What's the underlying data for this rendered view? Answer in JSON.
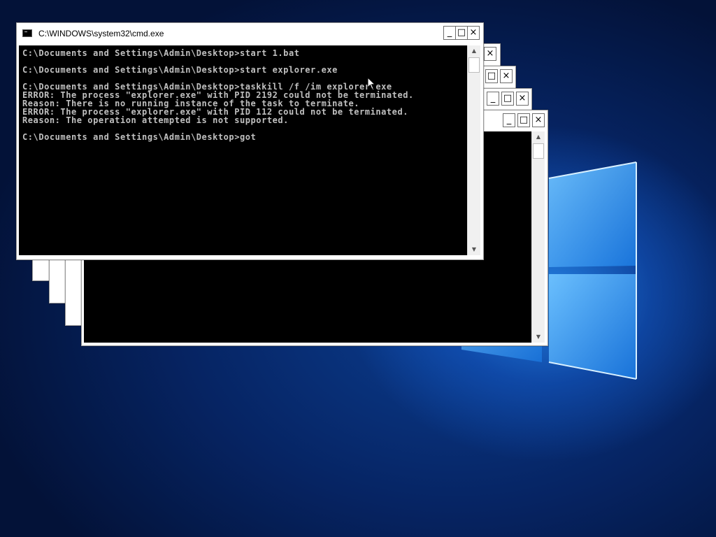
{
  "desktop": {
    "background_colors": {
      "deep": "#031238",
      "mid": "#0b3d8f",
      "glow": "#2a8cf0"
    }
  },
  "windows": {
    "main": {
      "title": "C:\\WINDOWS\\system32\\cmd.exe",
      "buttons": {
        "minimize": "_",
        "maximize": "□",
        "close": "×"
      },
      "console_lines": [
        "C:\\Documents and Settings\\Admin\\Desktop>start 1.bat",
        "",
        "C:\\Documents and Settings\\Admin\\Desktop>start explorer.exe",
        "",
        "C:\\Documents and Settings\\Admin\\Desktop>taskkill /f /im explorer.exe",
        "ERROR: The process \"explorer.exe\" with PID 2192 could not be terminated.",
        "Reason: There is no running instance of the task to terminate.",
        "ERROR: The process \"explorer.exe\" with PID 112 could not be terminated.",
        "Reason: The operation attempted is not supported.",
        "",
        "C:\\Documents and Settings\\Admin\\Desktop>got"
      ]
    },
    "stacked": {
      "buttons": {
        "minimize": "_",
        "maximize": "□",
        "close": "×"
      }
    }
  },
  "icons": {
    "scroll_up": "▲",
    "scroll_down": "▼",
    "console_app": "cmd-icon",
    "pointer": "mouse-pointer-icon"
  }
}
